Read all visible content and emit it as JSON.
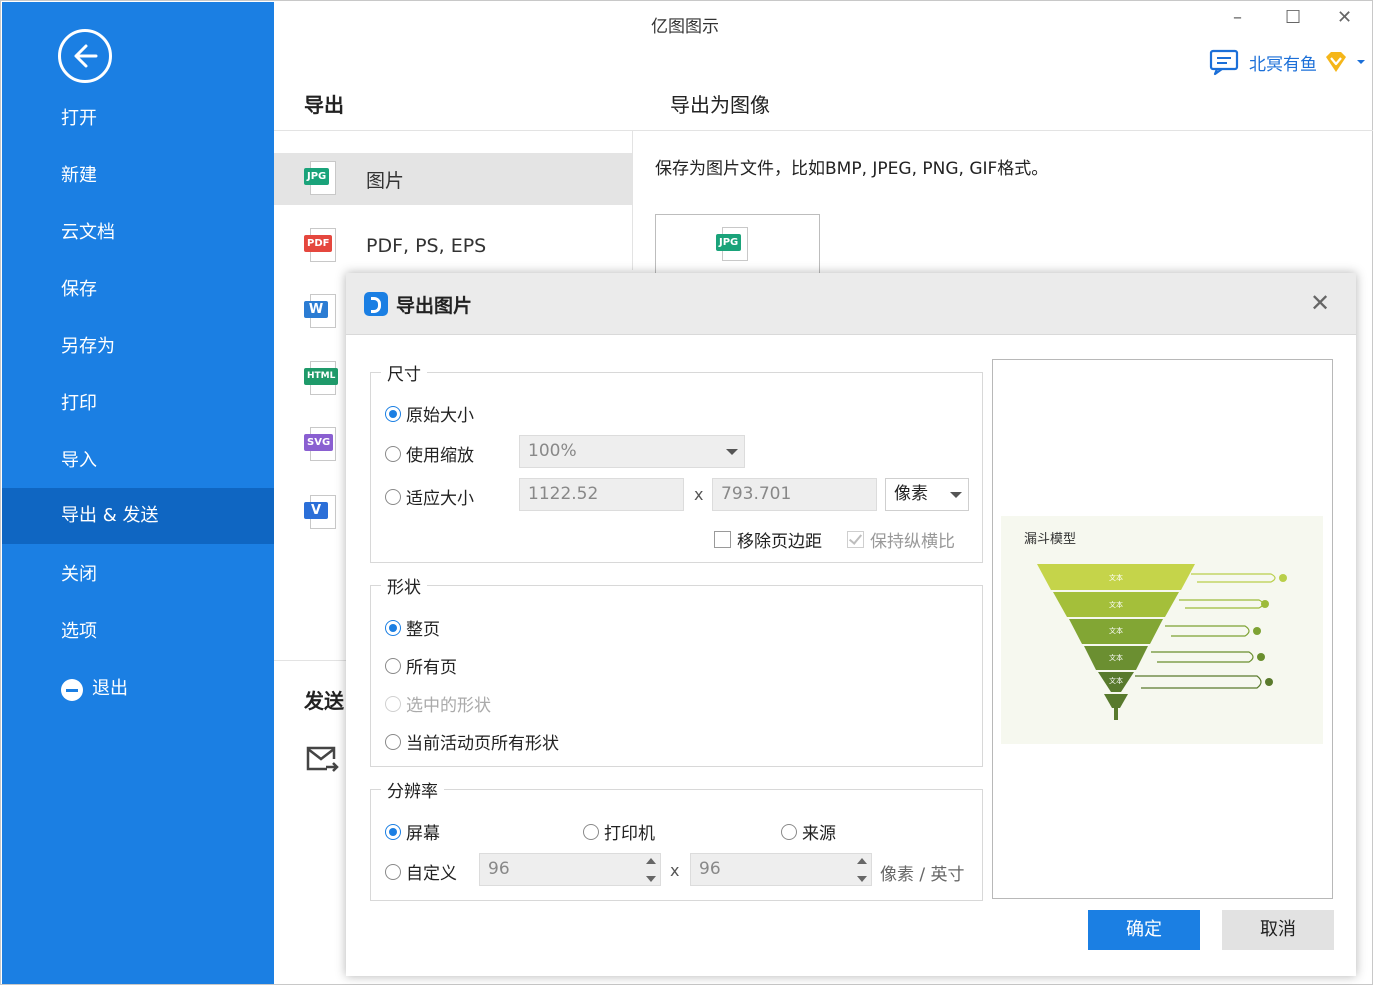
{
  "window": {
    "title": "亿图图示",
    "minimize": "–",
    "maximize": "☐",
    "close": "✕"
  },
  "user": {
    "name": "北冥有鱼"
  },
  "sidebar": {
    "items": [
      {
        "label": "打开"
      },
      {
        "label": "新建"
      },
      {
        "label": "云文档"
      },
      {
        "label": "保存"
      },
      {
        "label": "另存为"
      },
      {
        "label": "打印"
      },
      {
        "label": "导入"
      },
      {
        "label": "导出 & 发送"
      },
      {
        "label": "关闭"
      },
      {
        "label": "选项"
      },
      {
        "label": "退出"
      }
    ],
    "active_index": 7
  },
  "export_panel": {
    "heading": "导出",
    "formats": [
      {
        "badge": "JPG",
        "label": "图片",
        "color": "#1aa37a"
      },
      {
        "badge": "PDF",
        "label": "PDF, PS, EPS",
        "color": "#e5473e"
      },
      {
        "badge": "W",
        "label": "",
        "color": "#2b7cd3"
      },
      {
        "badge": "HTML",
        "label": "",
        "color": "#1f9a6a"
      },
      {
        "badge": "SVG",
        "label": "",
        "color": "#8a5fd1"
      },
      {
        "badge": "V",
        "label": "",
        "color": "#2b6fd8"
      }
    ],
    "send_heading": "发送"
  },
  "detail": {
    "heading": "导出为图像",
    "description": "保存为图片文件，比如BMP, JPEG, PNG, GIF格式。",
    "thumb_badge": "JPG"
  },
  "dialog": {
    "title": "导出图片",
    "size": {
      "title": "尺寸",
      "original": "原始大小",
      "scale": "使用缩放",
      "scale_value": "100%",
      "fit": "适应大小",
      "width": "1122.52",
      "x": "x",
      "height": "793.701",
      "unit": "像素",
      "remove_margin": "移除页边距",
      "keep_ratio": "保持纵横比"
    },
    "shape": {
      "title": "形状",
      "whole_page": "整页",
      "all_pages": "所有页",
      "selected": "选中的形状",
      "current_all": "当前活动页所有形状"
    },
    "resolution": {
      "title": "分辨率",
      "screen": "屏幕",
      "printer": "打印机",
      "source": "来源",
      "custom": "自定义",
      "dpi_x": "96",
      "x": "x",
      "dpi_y": "96",
      "unit": "像素 / 英寸"
    },
    "preview_title": "漏斗模型",
    "preview_layers": [
      "文本",
      "文本",
      "文本",
      "文本",
      "文本"
    ],
    "ok": "确定",
    "cancel": "取消"
  }
}
